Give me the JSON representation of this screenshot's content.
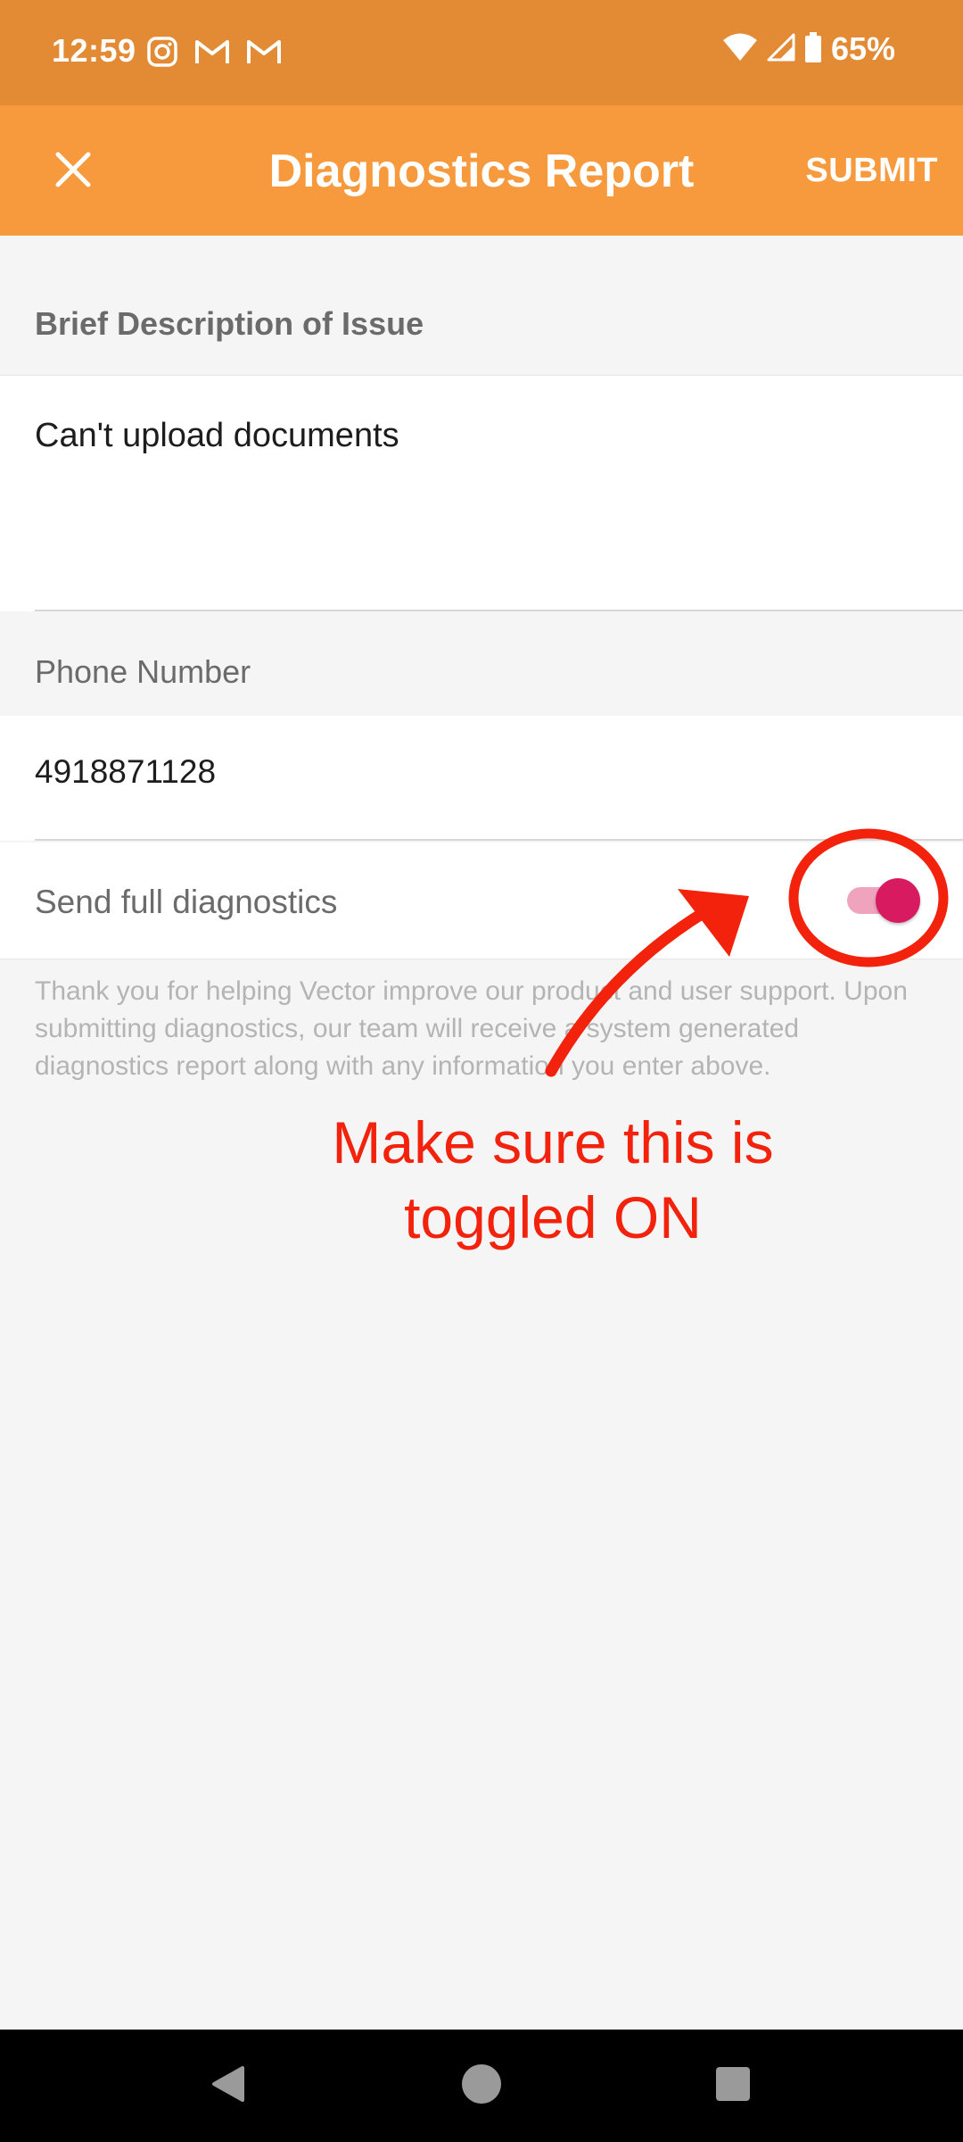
{
  "status_bar": {
    "time": "12:59",
    "battery": "65%",
    "icons": [
      "instagram-icon",
      "gmail-icon",
      "gmail-icon",
      "wifi-icon",
      "signal-icon",
      "battery-icon"
    ]
  },
  "app_bar": {
    "title": "Diagnostics Report",
    "submit_label": "SUBMIT",
    "close_icon": "close-icon"
  },
  "form": {
    "description_label": "Brief Description of Issue",
    "description_value": "Can't upload documents",
    "phone_label": "Phone Number",
    "phone_value": "4918871128",
    "diagnostics_toggle": {
      "label": "Send full diagnostics",
      "on": true
    },
    "help_text": "Thank you for helping Vector improve our product and user support. Upon submitting diagnostics, our team will receive a system generated diagnostics report along with any information you enter above."
  },
  "annotation": {
    "text_line1": "Make sure this is",
    "text_line2": "toggled ON",
    "color": "#f2220d"
  },
  "colors": {
    "status_bar": "#e28a34",
    "app_bar": "#f79a3d",
    "toggle_thumb": "#d81b60",
    "toggle_track": "#f0a3bd"
  },
  "nav_bar": {
    "icons": [
      "back-icon",
      "home-icon",
      "recents-icon"
    ]
  }
}
